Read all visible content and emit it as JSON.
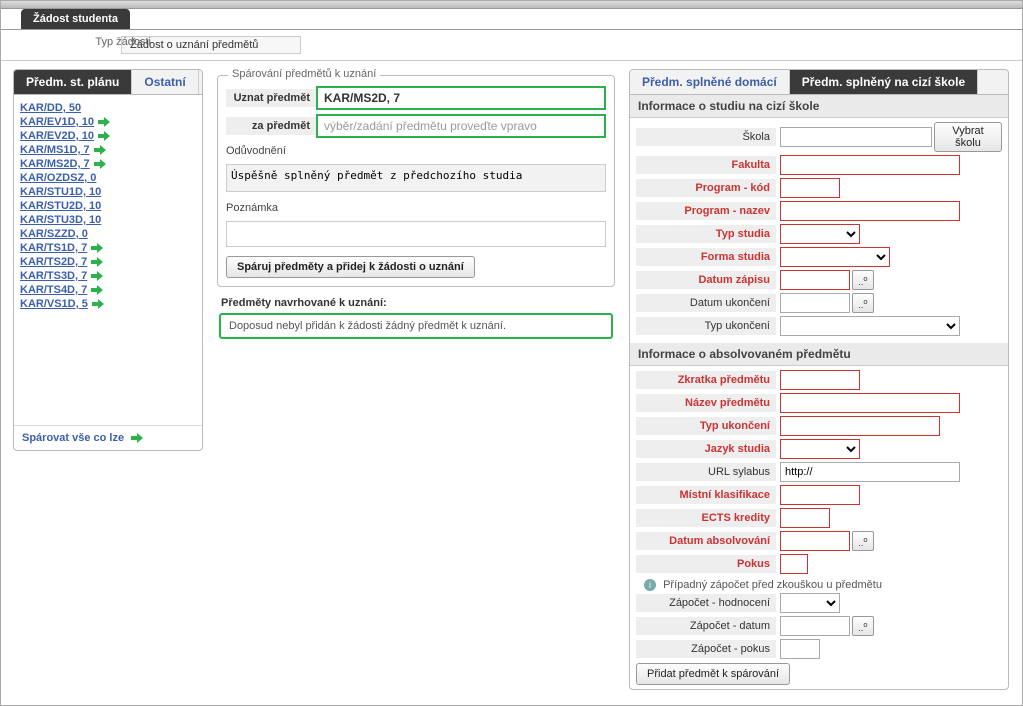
{
  "window": {
    "tab_title": "Žádost studenta",
    "type_label": "Typ žádosti",
    "type_value": "Žádost o uznání předmětů"
  },
  "left": {
    "tabs": [
      "Předm. st. plánu",
      "Ostatní"
    ],
    "active_tab": 0,
    "subjects": [
      {
        "label": "KAR/DD, 50",
        "arrow": false
      },
      {
        "label": "KAR/EV1D, 10",
        "arrow": true
      },
      {
        "label": "KAR/EV2D, 10",
        "arrow": true
      },
      {
        "label": "KAR/MS1D, 7",
        "arrow": true
      },
      {
        "label": "KAR/MS2D, 7",
        "arrow": true
      },
      {
        "label": "KAR/OZDSZ, 0",
        "arrow": false
      },
      {
        "label": "KAR/STU1D, 10",
        "arrow": false
      },
      {
        "label": "KAR/STU2D, 10",
        "arrow": false
      },
      {
        "label": "KAR/STU3D, 10",
        "arrow": false
      },
      {
        "label": "KAR/SZZD, 0",
        "arrow": false
      },
      {
        "label": "KAR/TS1D, 7",
        "arrow": true
      },
      {
        "label": "KAR/TS2D, 7",
        "arrow": true
      },
      {
        "label": "KAR/TS3D, 7",
        "arrow": true
      },
      {
        "label": "KAR/TS4D, 7",
        "arrow": true
      },
      {
        "label": "KAR/VS1D, 5",
        "arrow": true
      }
    ],
    "pair_all": "Spárovat vše co lze"
  },
  "middle": {
    "legend": "Spárování předmětů k uznání",
    "recognize_label": "Uznat předmět",
    "recognize_value": "KAR/MS2D, 7",
    "for_label": "za předmět",
    "for_placeholder": "výběr/zadání předmětu proveďte vpravo",
    "reason_label": "Odůvodnění",
    "reason_value": "Úspěšně splněný předmět z předchozího studia",
    "note_label": "Poznámka",
    "note_value": "",
    "pair_button": "Spáruj předměty a přidej k žádosti o uznání",
    "proposed_title": "Předměty navrhované k uznání:",
    "proposed_empty": "Doposud nebyl přidán k žádosti žádný předmět k uznání."
  },
  "right": {
    "tabs": [
      "Předm. splněné domácí",
      "Předm. splněný na cizí škole"
    ],
    "active_tab": 1,
    "section1": "Informace o studiu na cizí škole",
    "school_label": "Škola",
    "school_value": "",
    "school_button": "Vybrat školu",
    "faculty_label": "Fakulta",
    "program_code_label": "Program - kód",
    "program_name_label": "Program - nazev",
    "study_type_label": "Typ studia",
    "study_form_label": "Forma studia",
    "enroll_date_label": "Datum zápisu",
    "end_date_label": "Datum ukončení",
    "end_type_label": "Typ ukončení",
    "section2": "Informace o absolvovaném předmětu",
    "abbr_label": "Zkratka předmětu",
    "subj_name_label": "Název předmětu",
    "compl_type_label": "Typ ukončení",
    "lang_label": "Jazyk studia",
    "url_label": "URL sylabus",
    "url_value": "http://",
    "local_class_label": "Místní klasifikace",
    "ects_label": "ECTS kredity",
    "date_compl_label": "Datum absolvování",
    "attempt_label": "Pokus",
    "info_text": "Případný zápočet před zkouškou u předmětu",
    "credit_eval_label": "Zápočet - hodnocení",
    "credit_date_label": "Zápočet - datum",
    "credit_attempt_label": "Zápočet - pokus",
    "add_button": "Přidat předmět k spárování"
  }
}
